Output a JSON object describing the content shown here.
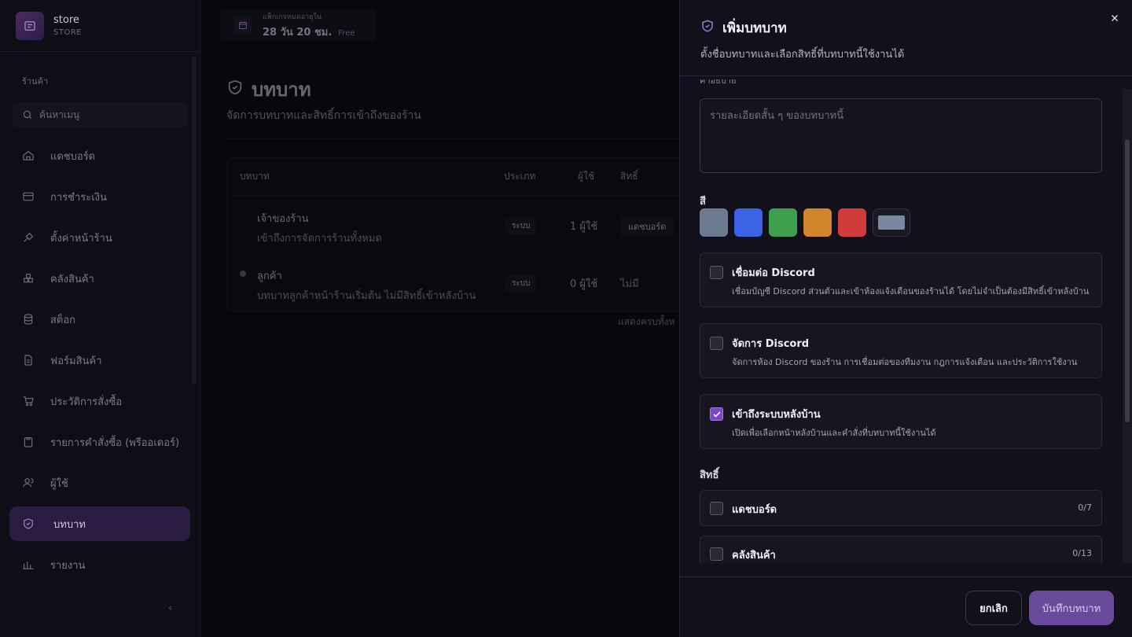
{
  "brand": {
    "name": "store",
    "sub": "STORE"
  },
  "sidebar": {
    "section": "ร้านค้า",
    "search_placeholder": "ค้นหาเมนู",
    "items": [
      {
        "label": "แดชบอร์ด"
      },
      {
        "label": "การชำระเงิน"
      },
      {
        "label": "ตั้งค่าหน้าร้าน"
      },
      {
        "label": "คลังสินค้า"
      },
      {
        "label": "สต็อก"
      },
      {
        "label": "ฟอร์มสินค้า"
      },
      {
        "label": "ประวัติการสั่งซื้อ"
      },
      {
        "label": "รายการคำสั่งซื้อ (พรีออเดอร์)"
      },
      {
        "label": "ผู้ใช้"
      },
      {
        "label": "บทบาท"
      },
      {
        "label": "รายงาน"
      }
    ]
  },
  "package": {
    "line1": "แพ็กเกจหมดอายุใน",
    "line2": "28 วัน 20 ชม.",
    "plan": "Free"
  },
  "page": {
    "title": "บทบาท",
    "subtitle": "จัดการบทบาทและสิทธิ์การเข้าถึงของร้าน",
    "table": {
      "headers": [
        "บทบาท",
        "ประเภท",
        "ผู้ใช้",
        "สิทธิ์"
      ],
      "rows": [
        {
          "name": "เจ้าของร้าน",
          "desc": "เข้าถึงการจัดการร้านทั้งหมด",
          "type": "ระบบ",
          "users": "1 ผู้ใช้",
          "perm": "แดชบอร์ด"
        },
        {
          "name": "ลูกค้า",
          "desc": "บทบาทลูกค้าหน้าร้านเริ่มต้น ไม่มีสิทธิ์เข้าหลังบ้าน",
          "type": "ระบบ",
          "users": "0 ผู้ใช้",
          "perm": "ไม่มี"
        }
      ],
      "footer": "แสดงครบทั้งห"
    }
  },
  "panel": {
    "title": "เพิ่มบทบาท",
    "subtitle": "ตั้งชื่อบทบาทและเลือกสิทธิ์ที่บทบาทนี้ใช้งานได้",
    "desc_label": "คำอธิบาย",
    "desc_placeholder": "รายละเอียดสั้น ๆ ของบทบาทนี้",
    "color_label": "สี",
    "colors": [
      "#6b7a8f",
      "#3b63e6",
      "#3f9e4f",
      "#d0842c",
      "#d03b3b"
    ],
    "custom_color": "#7a879e",
    "options": [
      {
        "title": "เชื่อมต่อ Discord",
        "desc": "เชื่อมบัญชี Discord ส่วนตัวและเข้าห้องแจ้งเตือนของร้านได้ โดยไม่จำเป็นต้องมีสิทธิ์เข้าหลังบ้าน",
        "checked": false
      },
      {
        "title": "จัดการ Discord",
        "desc": "จัดการห้อง Discord ของร้าน การเชื่อมต่อของทีมงาน กฎการแจ้งเตือน และประวัติการใช้งาน",
        "checked": false
      },
      {
        "title": "เข้าถึงระบบหลังบ้าน",
        "desc": "เปิดเพื่อเลือกหน้าหลังบ้านและคำสั่งที่บทบาทนี้ใช้งานได้",
        "checked": true
      }
    ],
    "perm_label": "สิทธิ์",
    "permissions": [
      {
        "title": "แดชบอร์ด",
        "count": "0/7"
      },
      {
        "title": "คลังสินค้า",
        "count": "0/13"
      }
    ],
    "cancel": "ยกเลิก",
    "save": "บันทึกบทบาท"
  }
}
